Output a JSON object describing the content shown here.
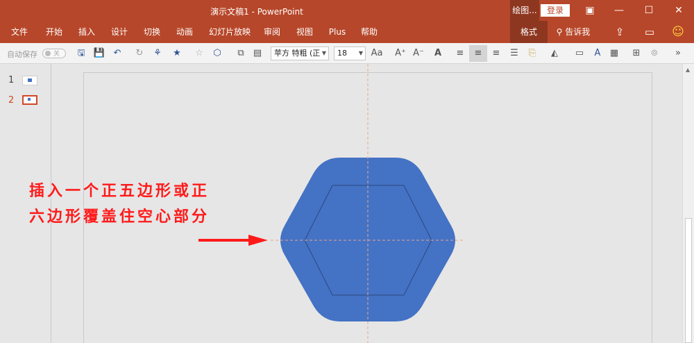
{
  "titlebar": {
    "title": "演示文稿1  -  PowerPoint",
    "context_tab": "绘图...",
    "login_label": "登录"
  },
  "ribbon": {
    "tabs": [
      "文件",
      "开始",
      "插入",
      "设计",
      "切换",
      "动画",
      "幻灯片放映",
      "审阅",
      "视图",
      "Plus",
      "帮助"
    ],
    "format_tab": "格式",
    "tell_me": "告诉我"
  },
  "toolbar": {
    "autosave_label": "自动保存",
    "autosave_state": "关",
    "font_name": "苹方 特粗 (正",
    "font_size": "18"
  },
  "thumbnails": [
    {
      "number": "1"
    },
    {
      "number": "2"
    }
  ],
  "annotation": {
    "line1": "插入一个正五边形或正",
    "line2": "六边形覆盖住空心部分"
  },
  "colors": {
    "accent": "#b7472a",
    "shape_fill": "#4472c4",
    "annotation": "#ff1a1a",
    "guide": "#e8a58f"
  }
}
